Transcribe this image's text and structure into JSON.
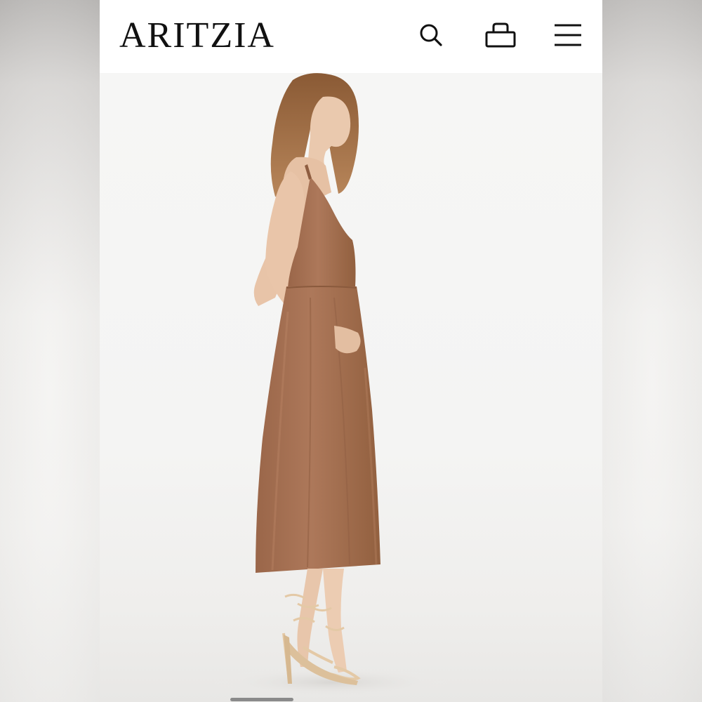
{
  "header": {
    "logo_text": "ARITZIA",
    "icons": [
      "search-icon",
      "shopping-bag-icon",
      "hamburger-menu-icon"
    ]
  },
  "product_image": {
    "subject": "dress-photo",
    "dress_color": "#a87456"
  },
  "colors": {
    "header_bg": "#ffffff",
    "logo": "#111111",
    "photo_bg": "#f4f4f3"
  }
}
